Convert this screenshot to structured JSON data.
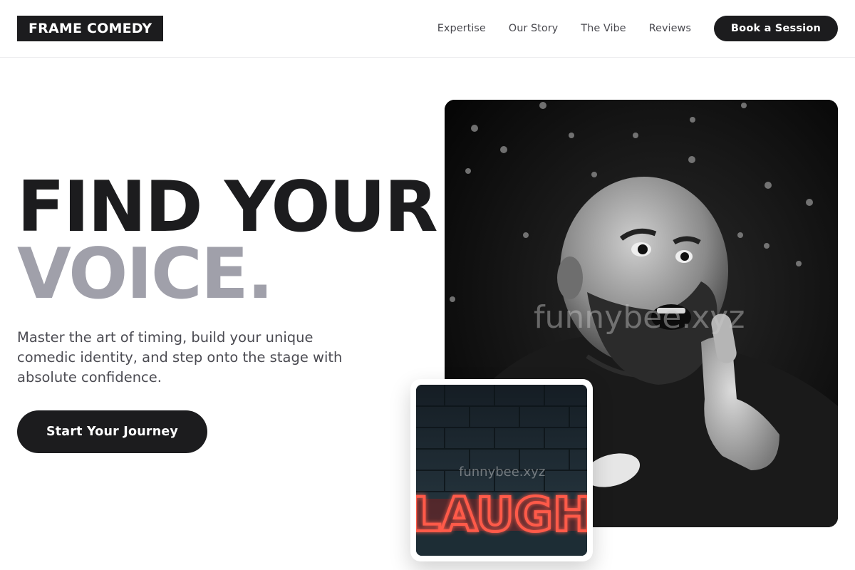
{
  "brand": {
    "logo_text": "FRAME COMEDY"
  },
  "nav": {
    "links": [
      "Expertise",
      "Our Story",
      "The Vibe",
      "Reviews"
    ],
    "cta_label": "Book a Session"
  },
  "hero": {
    "title_line1": "FIND YOUR",
    "title_line2": "VOICE.",
    "description": "Master the art of timing, build your unique comedic identity, and step onto the stage with absolute confidence.",
    "cta_label": "Start Your Journey"
  },
  "images": {
    "main_watermark": "funnybee.xyz",
    "inset_watermark": "funnybee.xyz",
    "inset_sign_text": "LAUGH"
  },
  "colors": {
    "dark": "#1c1c1e",
    "muted_title": "#a0a0aa",
    "neon_red": "#ff3b30"
  }
}
